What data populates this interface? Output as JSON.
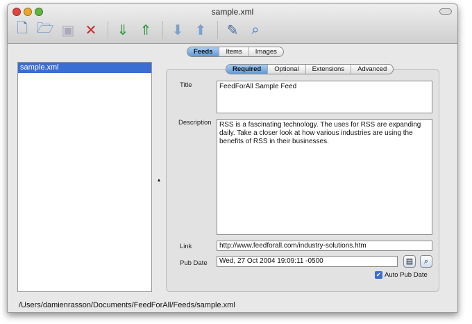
{
  "window": {
    "title": "sample.xml"
  },
  "toolbar": {
    "icons": [
      "new-feed-icon",
      "open-folder-icon",
      "save-icon",
      "close-feed-icon",
      "import-icon",
      "export-icon",
      "move-down-icon",
      "move-up-icon",
      "edit-xml-icon",
      "preview-icon"
    ]
  },
  "main_tabs": [
    {
      "label": "Feeds",
      "selected": true
    },
    {
      "label": "Items"
    },
    {
      "label": "Images"
    }
  ],
  "file_list": {
    "items": [
      "sample.xml"
    ],
    "selected": "sample.xml"
  },
  "sub_tabs": [
    {
      "label": "Required",
      "selected": true
    },
    {
      "label": "Optional"
    },
    {
      "label": "Extensions"
    },
    {
      "label": "Advanced"
    }
  ],
  "form": {
    "title_label": "Title",
    "title_value": "FeedForAll Sample Feed",
    "description_label": "Description",
    "description_value": "RSS is a fascinating technology. The uses for RSS are expanding daily. Take a closer look at how various industries are using the benefits of RSS in their businesses.",
    "link_label": "Link",
    "link_value": "http://www.feedforall.com/industry-solutions.htm",
    "pubdate_label": "Pub Date",
    "pubdate_value": "Wed, 27 Oct 2004 19:09:11 -0500",
    "auto_pubdate_label": "Auto Pub Date",
    "auto_pubdate_checked": true
  },
  "status_path": "/Users/damienrasson/Documents/FeedForAll/Feeds/sample.xml"
}
